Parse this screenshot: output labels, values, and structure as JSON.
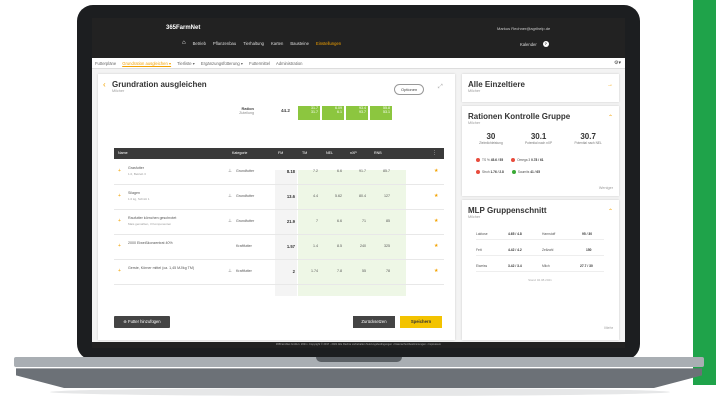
{
  "header": {
    "logo": "365FarmNet",
    "nav": [
      "Betrieb",
      "Pflanzenbau",
      "Tierhaltung",
      "Karten",
      "Bausteine",
      "Einstellungen"
    ],
    "user": "Markus Rechner@agrihelp.de",
    "kalender": "Kalender",
    "help": "?"
  },
  "subnav": [
    "Futterpläne",
    "Grundration ausgleichen ▾",
    "Tierliste ▾",
    "Ergänzungsfütterung ▾",
    "Futtermittel",
    "Administration"
  ],
  "main": {
    "title": "Grundration ausgleichen",
    "subtitle": "Milcher",
    "options_label": "Optionen",
    "ration_label": "Ration",
    "ration_sub": "Zuteilung",
    "ration_value": "44.2",
    "green_cells": [
      [
        "31.7",
        "31.7"
      ],
      [
        "6.09",
        "6.1"
      ],
      [
        "93.4",
        "93.7"
      ],
      [
        "55.8",
        "53.1"
      ]
    ],
    "columns": [
      "Name",
      "Kategorie",
      "FM",
      "TM",
      "NEL",
      "nXP",
      "RNB"
    ],
    "rows": [
      {
        "name": "Grasfutter",
        "sub": "1.0, Betrieb 3",
        "cat": "Grundfutter",
        "fm": "8.18",
        "c": [
          "7.2",
          "6.6",
          "91.7",
          "85.7"
        ]
      },
      {
        "name": "Silagen",
        "sub": "1.0 kg, Schnitt 1",
        "cat": "Grundfutter",
        "fm": "13.6",
        "c": [
          "4.4",
          "5.62",
          "80.4",
          "127"
        ]
      },
      {
        "name": "Raufutter körnchen geschrotet",
        "sub": "Mais gemahlen, 3 Komponenten",
        "cat": "Grundfutter",
        "fm": "21.9",
        "c": [
          "7",
          "6.6",
          "71",
          "85"
        ]
      },
      {
        "name": "2000 Eiweißkonzentrat 40%",
        "sub": "",
        "cat": "Kraftfutter",
        "fm": "1.57",
        "c": [
          "1.4",
          "8.5",
          "240",
          "325"
        ]
      },
      {
        "name": "Gerste, Körner mittel (ca. 1,45 MJ/kg TM)",
        "sub": "",
        "cat": "Kraftfutter",
        "fm": "2",
        "c": [
          "1.74",
          "7.8",
          "55",
          "78"
        ]
      }
    ],
    "add_button": "Futter hinzufügen",
    "reset_button": "Zurücksetzen",
    "save_button": "Speichern"
  },
  "panels": {
    "einzeltiere": {
      "title": "Alle Einzeltiere",
      "subtitle": "Milcher"
    },
    "kontrolle": {
      "title": "Rationen Kontrolle Gruppe",
      "subtitle": "Milcher",
      "kpis": [
        {
          "v": "30",
          "l": "Zielmilchleistung"
        },
        {
          "v": "30.1",
          "l": "Potential nach nXP"
        },
        {
          "v": "30.7",
          "l": "Potential nach NEL"
        }
      ],
      "chips1": [
        {
          "l": "TS %",
          "v": "45.6 / 55"
        },
        {
          "l": "Omega 3",
          "v": "0.78 / 61"
        }
      ],
      "chips2": [
        {
          "l": "Stroh",
          "v": "1.76 / 2.8"
        },
        {
          "l": "Saumits",
          "v": "41 / 65"
        }
      ],
      "more": "Weniger"
    },
    "mlp": {
      "title": "MLP Gruppenschnitt",
      "subtitle": "Milcher",
      "rows": [
        [
          "Laktose",
          "4.65 / 4.8",
          "Harnstoff",
          "95 / 30"
        ],
        [
          "Fett",
          "4.42 / 4.2",
          "Zellzahl",
          "150"
        ],
        [
          "Eiweiss",
          "3.42 / 3.4",
          "Milch",
          "27.7 / 30"
        ]
      ],
      "note": "Stand 02.08.2021",
      "more": "Mehr"
    }
  },
  "footer": "365FarmNet GmbH • 2021 • Copyright © 2017 - 2021 Alle Rechte vorbehalten Nutzungsbedingungen • Datenschutzbestimmungen • Impressum"
}
